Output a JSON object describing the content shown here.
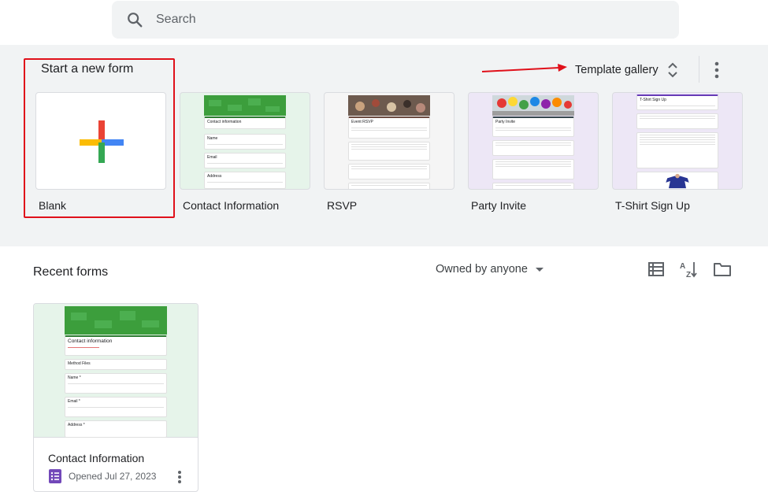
{
  "search": {
    "placeholder": "Search"
  },
  "templates_section": {
    "title": "Start a new form",
    "gallery_label": "Template gallery",
    "items": [
      {
        "label": "Blank"
      },
      {
        "label": "Contact Information",
        "thumb_title": "Contact information",
        "fields": [
          "Name",
          "Email",
          "Address"
        ]
      },
      {
        "label": "RSVP",
        "thumb_title": "Event RSVP"
      },
      {
        "label": "Party Invite",
        "thumb_title": "Party Invite"
      },
      {
        "label": "T-Shirt Sign Up",
        "thumb_title": "T-Shirt Sign Up"
      }
    ]
  },
  "recent_section": {
    "title": "Recent forms",
    "owner_filter": "Owned by anyone",
    "forms": [
      {
        "name": "Contact Information",
        "opened": "Opened Jul 27, 2023",
        "thumb_title": "Contact information",
        "fields": [
          "Method Files",
          "Name *",
          "Email *",
          "Address *"
        ]
      }
    ]
  },
  "colors": {
    "accent_red": "#e0101a",
    "forms_purple": "#7248b9",
    "template_bg": "#f1f3f4",
    "contact_green": "#3c9e3c"
  }
}
